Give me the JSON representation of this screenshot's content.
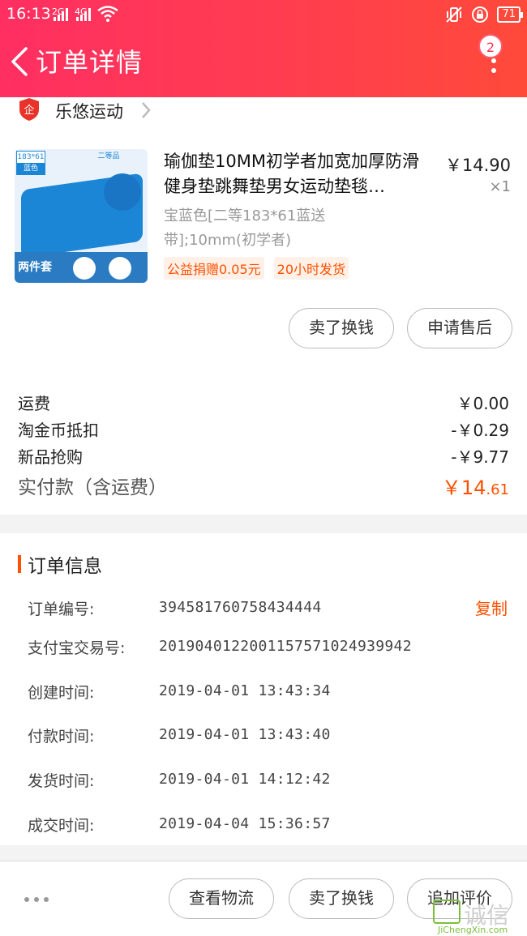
{
  "status_bar": {
    "time": "16:13",
    "signal1": "2G",
    "signal2": "4G",
    "battery": "71"
  },
  "header": {
    "title": "订单详情",
    "badge_count": "2"
  },
  "shop": {
    "name": "乐悠运动"
  },
  "product": {
    "title": "瑜伽垫10MM初学者加宽加厚防滑健身垫跳舞垫男女运动垫毯…",
    "price": "￥14.90",
    "quantity": "×1",
    "spec": "宝蓝色[二等183*61蓝送带];10mm(初学者)",
    "tags": [
      "公益捐赠0.05元",
      "20小时发货"
    ],
    "image_text": {
      "size": "183*61",
      "color": "蓝色",
      "grade": "二等品",
      "set": "两件套"
    }
  },
  "actions": {
    "sell": "卖了换钱",
    "after_sale": "申请售后"
  },
  "fees": [
    {
      "label": "运费",
      "value": "￥0.00"
    },
    {
      "label": "淘金币抵扣",
      "value": "-￥0.29"
    },
    {
      "label": "新品抢购",
      "value": "-￥9.77"
    }
  ],
  "total": {
    "label": "实付款（含运费）",
    "currency": "￥",
    "integer": "14",
    "decimal": ".61"
  },
  "order_info": {
    "title": "订单信息",
    "copy": "复制",
    "rows": [
      {
        "label": "订单编号:",
        "value": "394581760758434444"
      },
      {
        "label": "支付宝交易号:",
        "value": "2019040122001157571024939942"
      },
      {
        "label": "创建时间:",
        "value": "2019-04-01 13:43:34"
      },
      {
        "label": "付款时间:",
        "value": "2019-04-01 13:43:40"
      },
      {
        "label": "发货时间:",
        "value": "2019-04-01 14:12:42"
      },
      {
        "label": "成交时间:",
        "value": "2019-04-04 15:36:57"
      }
    ]
  },
  "bottom_bar": {
    "logistics": "查看物流",
    "sell": "卖了换钱",
    "add_review": "追加评价"
  },
  "watermark": {
    "text": "诚信",
    "sub": "JiChengXin.com"
  }
}
